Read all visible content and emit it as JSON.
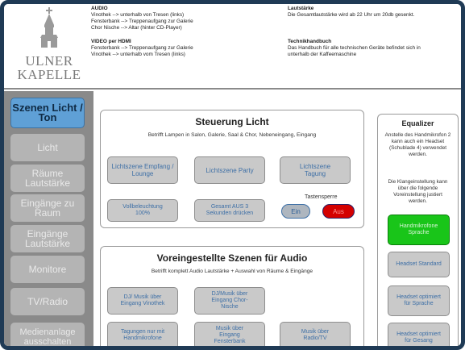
{
  "colors": {
    "frame": "#1f3a55",
    "sidebar_bg": "#8a8a8a",
    "sidebar_active": "#5fa0d6",
    "button_bg": "#c9c9c9",
    "button_text": "#3d6fa6",
    "ein_bg": "#aeb6bf",
    "aus_bg": "#d40000",
    "eq_active": "#19c519"
  },
  "logo": {
    "line1": "ULNER",
    "line2": "KAPELLE",
    "icon": "chapel-tower-icon"
  },
  "header": {
    "audio": {
      "title": "AUDIO",
      "lines": [
        "Vinothek --> unterhalb von Tresen (links)",
        "Fensterbank --> Treppenaufgang zur Galerie",
        "Chor Nische --> Altar (hinter CD-Player)"
      ]
    },
    "video": {
      "title": "VIDEO per HDMI",
      "lines": [
        "Fensterbank --> Treppenaufgang zur Galerie",
        "Vinothek --> unterhalb vom Tresen (links)"
      ]
    },
    "lautstaerke": {
      "title": "Lautstärke",
      "lines": [
        "Die Gesamtlautstärke wird ab 22 Uhr um 20db gesenkt."
      ]
    },
    "handbuch": {
      "title": "Technikhandbuch",
      "lines": [
        "Das Handbuch für alle technischen Geräte befindet sich in",
        "unterhalb der Kaffeemaschine"
      ]
    }
  },
  "sidebar": {
    "items": [
      {
        "label": "Szenen Licht / Ton",
        "active": true
      },
      {
        "label": "Licht"
      },
      {
        "label": "Räume Lautstärke"
      },
      {
        "label": "Eingänge zu Raum"
      },
      {
        "label": "Eingänge Lautstärke"
      },
      {
        "label": "Monitore"
      },
      {
        "label": "TV/Radio"
      },
      {
        "label": "Medienanlage ausschalten"
      }
    ]
  },
  "licht": {
    "title": "Steuerung Licht",
    "subtitle": "Betrifft Lampen in Salon, Galerie, Saal & Chor, Nebeneingang, Eingang",
    "scenes": [
      "Lichtszene Empfang / Lounge",
      "Lichtszene Party",
      "Lichtszene Tagung"
    ],
    "voll": "Vollbeleuchtung 100%",
    "aus": "Gesamt AUS 3 Sekunden drücken",
    "sperre_label": "Tastensperre",
    "ein": "Ein",
    "aus_btn": "Aus"
  },
  "audio": {
    "title": "Voreingestellte Szenen für Audio",
    "subtitle": "Betrifft komplett Audio Lautstärke + Auswahl von Räume & Eingänge",
    "buttons": [
      "DJ/ Musik über Eingang Vinothek",
      "DJ/Musik über Eingang Chor-Nische",
      "Tagungen nur mit Handmikrofone",
      "Musik über Eingang Fensterbank",
      "Musik über Radio/TV"
    ]
  },
  "equalizer": {
    "title": "Equalizer",
    "text1": "Anstelle des Handmikrofon 2 kann auch ein Headset (Schublade 4) verwendet werden.",
    "text2": "Die Klangeinstellung kann über die folgende Voreinstellung justiert werden.",
    "buttons": [
      {
        "label": "Handmikrofone Sprache",
        "active": true
      },
      {
        "label": "Headset Standard"
      },
      {
        "label": "Headset optimiert für Sprache"
      },
      {
        "label": "Headset optimiert für Gesang"
      }
    ]
  }
}
